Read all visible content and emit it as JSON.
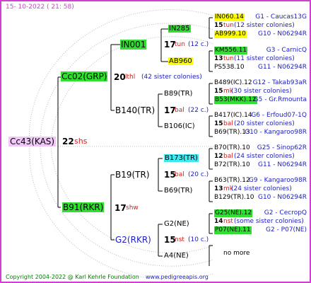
{
  "header": {
    "date": "15- 10-2022 ( 21: 58)"
  },
  "root": {
    "name": "Cc43(KAS)",
    "num": "22",
    "suffix": "shs"
  },
  "gen1": {
    "top": {
      "name": "Cc02(GRP)",
      "num": "20",
      "suffix": "lthl",
      "note": "(42 sister colonies)"
    },
    "bottom": {
      "name": "B91(RKR)",
      "num": "17",
      "suffix": "shw"
    }
  },
  "gen2": [
    {
      "name": "IN001",
      "num": "17",
      "suffix": "tun",
      "note": "(12 c.)"
    },
    {
      "name": "B140(TR)",
      "num": "17",
      "suffix": "bal",
      "note": "(22 c.)"
    },
    {
      "name": "B19(TR)",
      "num": "15",
      "suffix": "bal",
      "note": "(20 c.)"
    },
    {
      "name": "G2(RKR)",
      "num": "15",
      "suffix": "nst",
      "note": "(10 c.)"
    }
  ],
  "gen3": [
    {
      "name": "IN285"
    },
    {
      "name": "AB960"
    },
    {
      "name": "B89(TR)"
    },
    {
      "name": "B106(IC)"
    },
    {
      "name": "B173(TR)"
    },
    {
      "name": "B69(TR)"
    },
    {
      "name": "G2(NE)"
    },
    {
      "name": "A4(NE)"
    }
  ],
  "gen4": [
    {
      "name": "IN060.14",
      "right": "G1 - Caucas13G"
    },
    {
      "num": "15",
      "suffix": "tun",
      "note": "(12 sister colonies)"
    },
    {
      "name": "AB999.10",
      "right": "G10 - N06294R"
    },
    {
      "name": "KM556.11",
      "right": "G3 - CarnicQ"
    },
    {
      "num": "13",
      "suffix": "tun",
      "note": "(11 sister colonies)"
    },
    {
      "name": "PS538.10",
      "right": "G11 - N06294R"
    },
    {
      "name": "B489(IC).12",
      "right": "G12 - Takab93aR"
    },
    {
      "num": "15",
      "suffix": "mk",
      "note": "(30 sister colonies)"
    },
    {
      "name": "B53(MKK).12",
      "right": "G5 - Gr.Rmounta"
    },
    {
      "name": "B417(IC).14",
      "right": "G6 - Erfoud07-1Q"
    },
    {
      "num": "15",
      "suffix": "bal",
      "note": "(20 sister colonies)"
    },
    {
      "name": "B69(TR).13",
      "right": "G10 - Kangaroo98R"
    },
    {
      "name": "B70(TR).10",
      "right": "G25 - Sinop62R"
    },
    {
      "num": "12",
      "suffix": "bal",
      "note": "(24 sister colonies)"
    },
    {
      "name": "B72(TR).10",
      "right": "G11 - N06294R"
    },
    {
      "name": "B63(TR).12",
      "right": "G9 - Kangaroo98R"
    },
    {
      "num": "13",
      "suffix": "mk",
      "note": "(24 sister colonies)"
    },
    {
      "name": "B129(TR).10",
      "right": "G10 - N06294R"
    },
    {
      "name": "G25(NE).12",
      "right": "G2 - CecropQ"
    },
    {
      "num": "14",
      "suffix": "nst",
      "note": "(some sister colonies)"
    },
    {
      "name": "P07(NE).11",
      "right": "G2 - P07(NE)"
    },
    {
      "name": "no more"
    }
  ],
  "footer": {
    "copyright": "Copyright 2004-2022 @ Karl Kehrle Foundation",
    "site": "www.pedigreeapis.org"
  }
}
